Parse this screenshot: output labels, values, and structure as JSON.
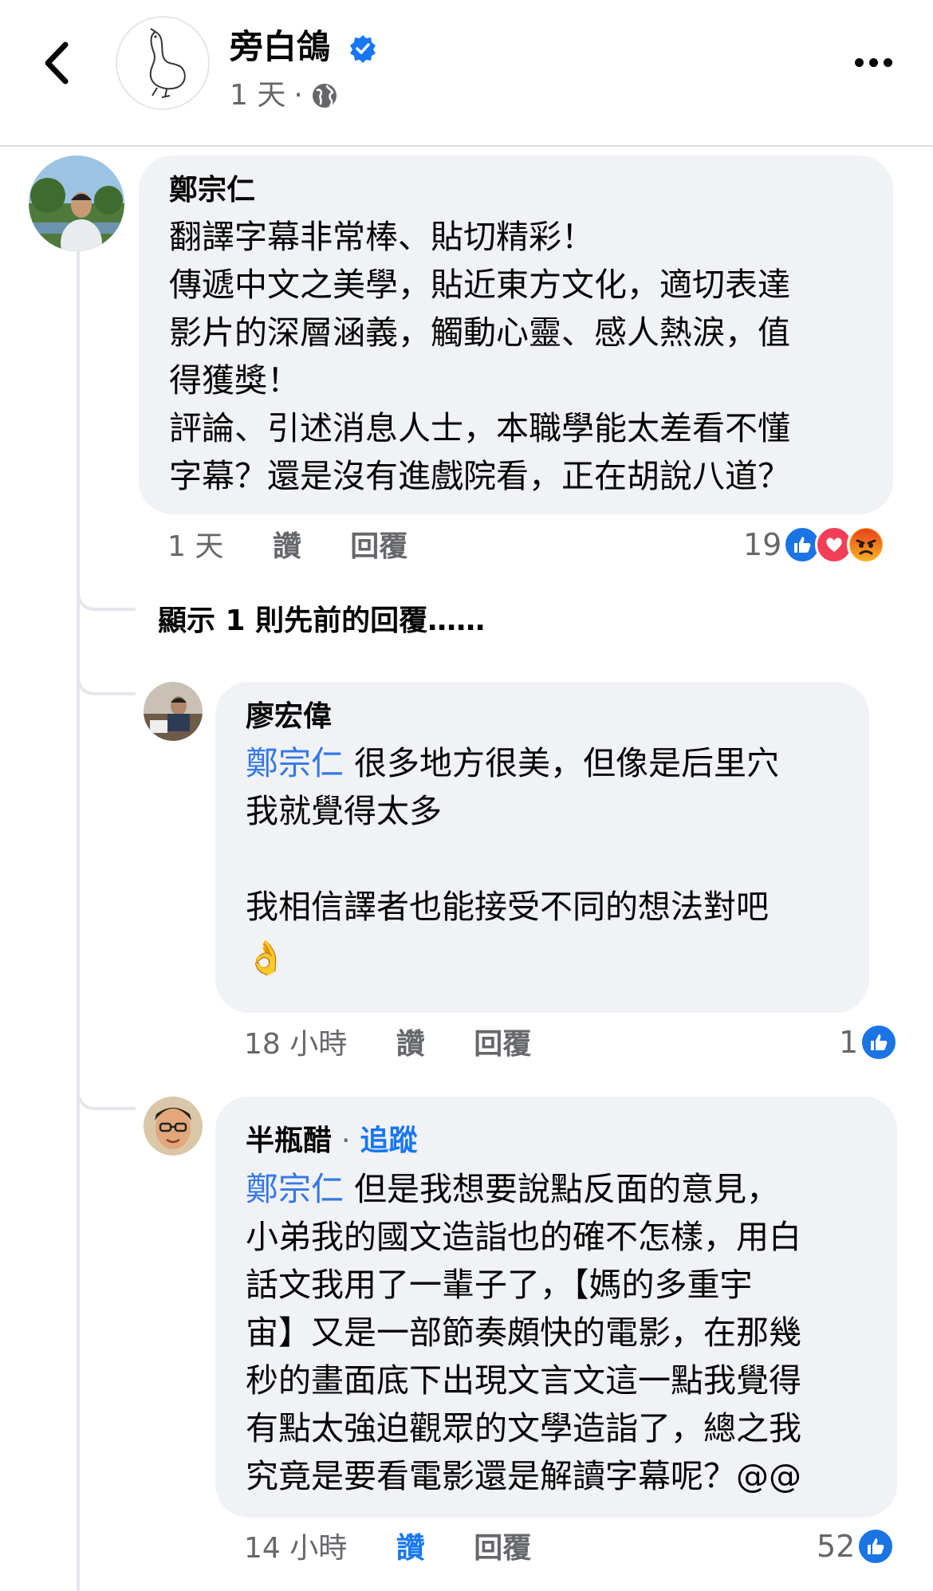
{
  "header": {
    "page_name": "旁白鴿",
    "post_time": "1 天",
    "dot": "·",
    "icons": {
      "back": "chevron-left-icon",
      "verified": "verified-badge-icon",
      "privacy": "globe-icon",
      "more": "more-dots-icon"
    }
  },
  "comments": [
    {
      "author": "鄭宗仁",
      "lines": [
        "翻譯字幕非常棒、貼切精彩！",
        "傳遞中文之美學，貼近東方文化，適切表達",
        "影片的深層涵義，觸動心靈、感人熱淚，值",
        "得獲獎！",
        "評論、引述消息人士，本職學能太差看不懂",
        "字幕？還是沒有進戲院看，正在胡說八道？"
      ],
      "time": "1 天",
      "like_label": "讚",
      "reply_label": "回覆",
      "reaction_count": "19",
      "reactions": [
        "like",
        "love",
        "angry"
      ]
    }
  ],
  "show_previous_replies": "顯示 1 則先前的回覆……",
  "replies": [
    {
      "author": "廖宏偉",
      "mention": "鄭宗仁",
      "lines": [
        " 很多地方很美，但像是后里穴",
        "我就覺得太多",
        "",
        "我相信譯者也能接受不同的想法對吧",
        "👌"
      ],
      "time": "18 小時",
      "like_label": "讚",
      "reply_label": "回覆",
      "reaction_count": "1",
      "reactions": [
        "like"
      ]
    },
    {
      "author": "半瓶醋",
      "follow_label": "追蹤",
      "mention": "鄭宗仁",
      "lines": [
        " 但是我想要說點反面的意見，",
        "小弟我的國文造詣也的確不怎樣，用白",
        "話文我用了一輩子了，【媽的多重宇",
        "宙】又是一部節奏頗快的電影，在那幾",
        "秒的畫面底下出現文言文這一點我覺得",
        "有點太強迫觀眾的文學造詣了，總之我",
        "究竟是要看電影還是解讀字幕呢？@@"
      ],
      "time": "14 小時",
      "like_label": "讚",
      "reply_label": "回覆",
      "reaction_count": "52",
      "reactions": [
        "like"
      ],
      "liked_by_viewer": true
    }
  ],
  "colors": {
    "bubble": "#f0f2f5",
    "mention": "#3578e5",
    "like_blue": "#1877f2",
    "secondary_text": "#65676b"
  }
}
